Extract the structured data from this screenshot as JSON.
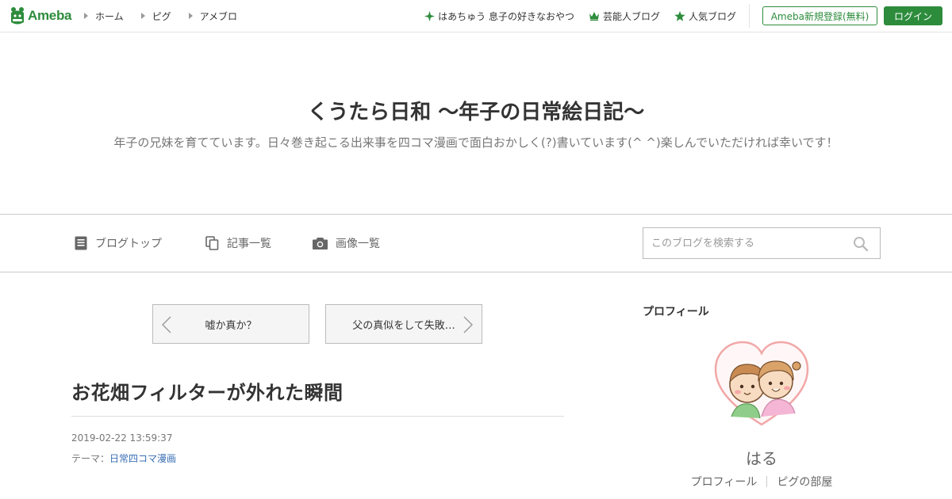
{
  "brand": {
    "logo_text": "Ameba",
    "accent": "#2d8c3c"
  },
  "topnav": {
    "left": [
      {
        "label": "ホーム"
      },
      {
        "label": "ピグ"
      },
      {
        "label": "アメブロ"
      }
    ],
    "right": [
      {
        "label": "はあちゅう 息子の好きなおやつ",
        "icon": "sparkle-icon"
      },
      {
        "label": "芸能人ブログ",
        "icon": "crown-icon"
      },
      {
        "label": "人気ブログ",
        "icon": "star-icon"
      }
    ],
    "register_label": "Ameba新規登録(無料)",
    "login_label": "ログイン"
  },
  "blog": {
    "title": "くうたら日和 〜年子の日常絵日記〜",
    "description": "年子の兄妹を育てています。日々巻き起こる出来事を四コマ漫画で面白おかしく(?)書いています(^ ^)楽しんでいただければ幸いです！"
  },
  "subnav": {
    "items": [
      {
        "label": "ブログトップ",
        "icon": "document-icon"
      },
      {
        "label": "記事一覧",
        "icon": "copy-icon"
      },
      {
        "label": "画像一覧",
        "icon": "camera-icon"
      }
    ],
    "search_placeholder": "このブログを検索する"
  },
  "article": {
    "prev_label": "嘘か真か？",
    "next_label": "父の真似をして失敗…",
    "title": "お花畑フィルターが外れた瞬間",
    "date": "2019-02-22 13:59:37",
    "theme_prefix": "テーマ：",
    "theme": "日常四コマ漫画"
  },
  "sidebar": {
    "heading": "プロフィール",
    "profile_name": "はる",
    "links": [
      {
        "label": "プロフィール"
      },
      {
        "label": "ピグの部屋"
      }
    ]
  }
}
